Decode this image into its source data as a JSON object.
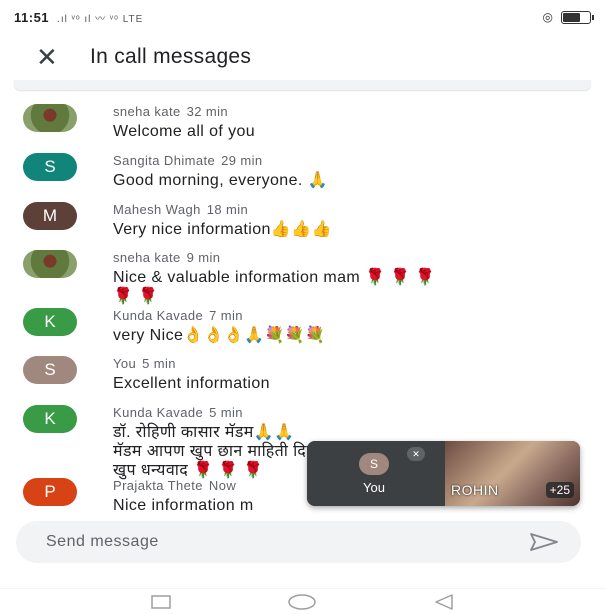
{
  "status_bar": {
    "time": "11:51",
    "signal": ".ıl ᵛᵒ ıl 〰 ᵛᵒ LTE",
    "battery_level": 0.6
  },
  "app_bar": {
    "title": "In call messages"
  },
  "messages": [
    {
      "sender": "sneha kate",
      "time": "32 min",
      "text": "Welcome all of you",
      "avatar_type": "photo"
    },
    {
      "sender": "Sangita Dhimate",
      "time": "29 min",
      "text": "Good morning, everyone. 🙏",
      "avatar_letter": "S",
      "avatar_color": "#12857a"
    },
    {
      "sender": "Mahesh Wagh",
      "time": "18 min",
      "text": "Very nice information👍👍👍",
      "avatar_letter": "M",
      "avatar_color": "#5d4037"
    },
    {
      "sender": "sneha kate",
      "time": "9 min",
      "text": "Nice & valuable information mam 🌹 🌹 🌹\n🌹 🌹",
      "avatar_type": "photo"
    },
    {
      "sender": "Kunda Kavade",
      "time": "7 min",
      "text": "very Nice👌👌👌🙏💐💐💐",
      "avatar_letter": "K",
      "avatar_color": "#3a9b46"
    },
    {
      "sender": "You",
      "time": "5 min",
      "text": "Excellent information",
      "avatar_letter": "S",
      "avatar_color": "#a1887f"
    },
    {
      "sender": "Kunda Kavade",
      "time": "5 min",
      "text": "डॉ. रोहिणी कासार मॅडम🙏🙏\nमॅडम आपण खुप छान माहिती दिली\nखुप धन्यवाद 🌹 🌹 🌹",
      "avatar_letter": "K",
      "avatar_color": "#3a9b46"
    },
    {
      "sender": "Prajakta Thete",
      "time": "Now",
      "text": "Nice information m",
      "avatar_letter": "P",
      "avatar_color": "#d84315"
    }
  ],
  "pip": {
    "self_letter": "S",
    "self_label": "You",
    "remote_name": "ROHIN",
    "more_count": "+25"
  },
  "composer": {
    "placeholder": "Send message"
  }
}
